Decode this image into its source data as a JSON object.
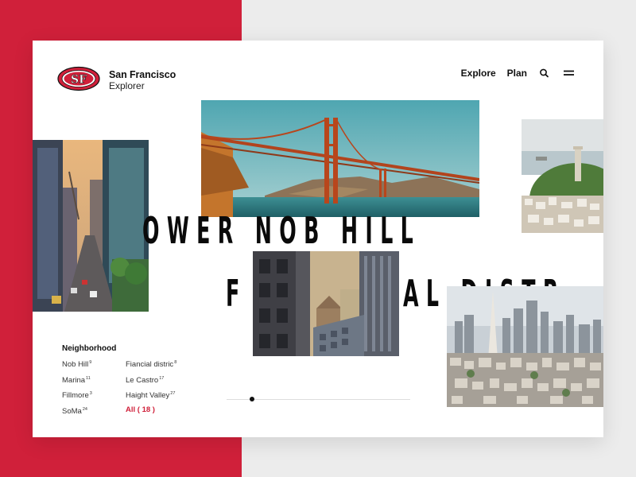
{
  "colors": {
    "accent": "#d0203a",
    "background_left": "#d0203a",
    "background_right": "#ececec",
    "card": "#ffffff"
  },
  "brand": {
    "logo_text": "SF",
    "title": "San Francisco",
    "subtitle": "Explorer"
  },
  "nav": {
    "items": [
      {
        "label": "Explore"
      },
      {
        "label": "Plan"
      }
    ],
    "search_icon": "search-icon",
    "menu_icon": "menu-icon"
  },
  "hero_text": {
    "line1": "OWER NOB HILL",
    "line2_left": "F",
    "line2_right": "AL DISTR"
  },
  "neighborhood": {
    "title": "Neighborhood",
    "col1": [
      {
        "name": "Nob Hill",
        "count": "9"
      },
      {
        "name": "Marina",
        "count": "11"
      },
      {
        "name": "Fillmore",
        "count": "3"
      },
      {
        "name": "SoMa",
        "count": "24"
      }
    ],
    "col2": [
      {
        "name": "Fiancial distric",
        "count": "8"
      },
      {
        "name": "Le Castro",
        "count": "17"
      },
      {
        "name": "Haight Valley",
        "count": "27"
      }
    ],
    "all_label": "All ( 18 )"
  },
  "slider": {
    "current": 1
  }
}
